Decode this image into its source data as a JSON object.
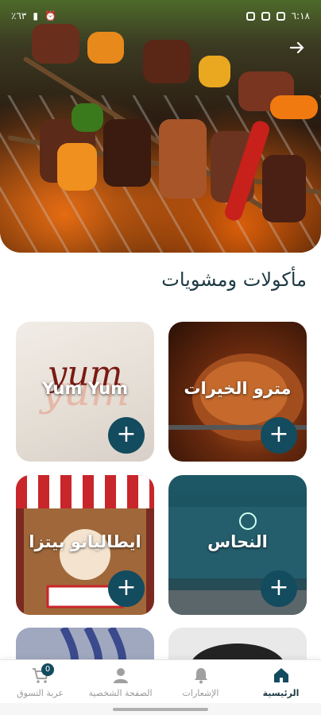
{
  "status_bar": {
    "time": "٦:١٨",
    "battery": "٪٦٣"
  },
  "section": {
    "title": "مأكولات ومشويات"
  },
  "restaurants": [
    {
      "name": "Yum Yum",
      "add_label": "+"
    },
    {
      "name": "مترو الخيرات",
      "add_label": "+"
    },
    {
      "name": "ايطاليانو بيتزا",
      "add_label": "+"
    },
    {
      "name": "النحاس",
      "add_label": "+"
    }
  ],
  "nav": {
    "items": [
      {
        "label": "الرئيسية",
        "icon": "home-icon",
        "active": true
      },
      {
        "label": "الإشعارات",
        "icon": "bell-icon",
        "active": false
      },
      {
        "label": "الصفحة الشخصية",
        "icon": "user-icon",
        "active": false
      },
      {
        "label": "عربة التسوق",
        "icon": "cart-icon",
        "active": false,
        "badge": "0"
      }
    ]
  },
  "colors": {
    "accent": "#134b5f",
    "title": "#1e3a44"
  }
}
